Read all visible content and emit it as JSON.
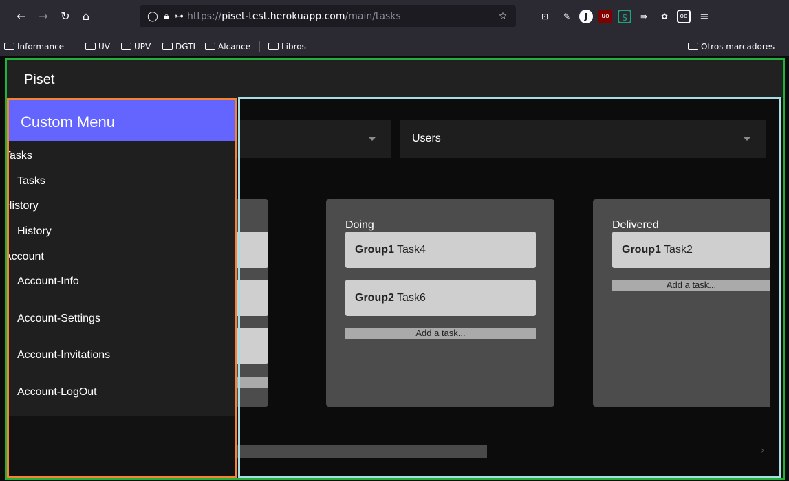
{
  "browser": {
    "url_prefix": "https://",
    "url_host": "piset-test.herokuapp.com",
    "url_path": "/main/tasks",
    "bookmarks": [
      "Informance",
      "UV",
      "UPV",
      "DGTI",
      "Alcance",
      "Libros"
    ],
    "other_bookmarks": "Otros marcadores"
  },
  "app": {
    "title": "Piset",
    "select_users": "Users"
  },
  "columns": [
    {
      "title": "Doing",
      "cards": [
        {
          "group": "Group1",
          "task": "Task4"
        },
        {
          "group": "Group2",
          "task": "Task6"
        }
      ],
      "add_label": "Add a task..."
    },
    {
      "title": "Delivered",
      "cards": [
        {
          "group": "Group1",
          "task": "Task2"
        }
      ],
      "add_label": "Add a task..."
    }
  ],
  "drawer": {
    "title": "Custom Menu",
    "sections": [
      {
        "head": "Tasks",
        "items": [
          "Tasks"
        ]
      },
      {
        "head": "History",
        "items": [
          "History"
        ]
      },
      {
        "head": "Account",
        "items": [
          "Account-Info",
          "Account-Settings",
          "Account-Invitations",
          "Account-LogOut"
        ]
      }
    ]
  },
  "colors": {
    "drawer_header": "#6464fe",
    "outline_green": "#22b13b",
    "outline_orange": "#f58332",
    "outline_blue": "#a8dde3"
  }
}
